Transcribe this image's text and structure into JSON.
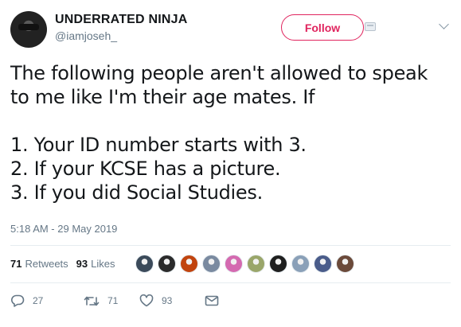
{
  "user": {
    "display_name": "UNDERRATED NINJA",
    "handle": "@iamjoseh_"
  },
  "follow_label": "Follow",
  "tweet": {
    "lines": [
      "The following people aren't allowed to speak",
      "to me like I'm their age mates. If",
      "",
      "1. Your ID number starts with 3.",
      "2. If your KCSE has a picture.",
      "3. If you did Social Studies."
    ],
    "timestamp": "5:18 AM - 29 May 2019"
  },
  "stats": {
    "retweets_count": "71",
    "retweets_label": "Retweets",
    "likes_count": "93",
    "likes_label": "Likes"
  },
  "likers": [
    {
      "icon": "avatar",
      "color": "#3b4a5a"
    },
    {
      "icon": "avatar",
      "color": "#2b2b2b"
    },
    {
      "icon": "avatar",
      "color": "#c1440e"
    },
    {
      "icon": "avatar",
      "color": "#7a8aa0"
    },
    {
      "icon": "avatar",
      "color": "#d46ab0"
    },
    {
      "icon": "avatar",
      "color": "#9aa66a"
    },
    {
      "icon": "avatar",
      "color": "#1f1f1f"
    },
    {
      "icon": "avatar",
      "color": "#8aa0b8"
    },
    {
      "icon": "avatar",
      "color": "#4a5c8a"
    },
    {
      "icon": "avatar",
      "color": "#6b4a3a"
    }
  ],
  "actions": {
    "reply_count": "27",
    "retweet_count": "71",
    "like_count": "93"
  },
  "colors": {
    "accent": "#e0245e",
    "muted": "#657786",
    "text": "#14171a",
    "divider": "#e6ecf0"
  }
}
